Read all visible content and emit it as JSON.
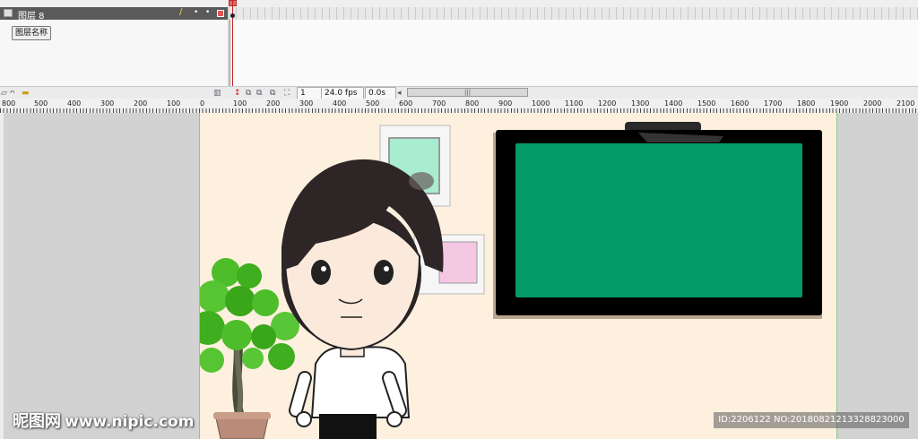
{
  "timeline": {
    "layer_name": "图层 8",
    "layer_name_button": "图层名称",
    "frame_number": "1",
    "fps": "24.0 fps",
    "elapsed": "0.0s"
  },
  "ruler_labels": [
    "800",
    "500",
    "400",
    "300",
    "200",
    "100",
    "0",
    "100",
    "200",
    "300",
    "400",
    "500",
    "600",
    "700",
    "800",
    "900",
    "1000",
    "1100",
    "1200",
    "1300",
    "1400",
    "1500",
    "1600",
    "1700",
    "1800",
    "1900",
    "2000",
    "2100"
  ],
  "watermark": {
    "brand": "昵图网",
    "url": "www.nipic.com"
  },
  "image_id": "ID:2206122 NO:20180821213328823000",
  "colors": {
    "stage": "#fdf0de",
    "tv_screen": "#049a68",
    "hair": "#2e2526",
    "plant": "#4dbd2a",
    "playhead": "#cc2020"
  },
  "icons": [
    "pencil-icon",
    "lock-dot-icon",
    "visibility-dot-icon",
    "outline-square-icon",
    "add-layer-icon",
    "add-guide-icon",
    "folder-icon",
    "trash-icon",
    "onion-skin-icon",
    "edit-multiple-frames-icon",
    "modify-markers-icon"
  ]
}
